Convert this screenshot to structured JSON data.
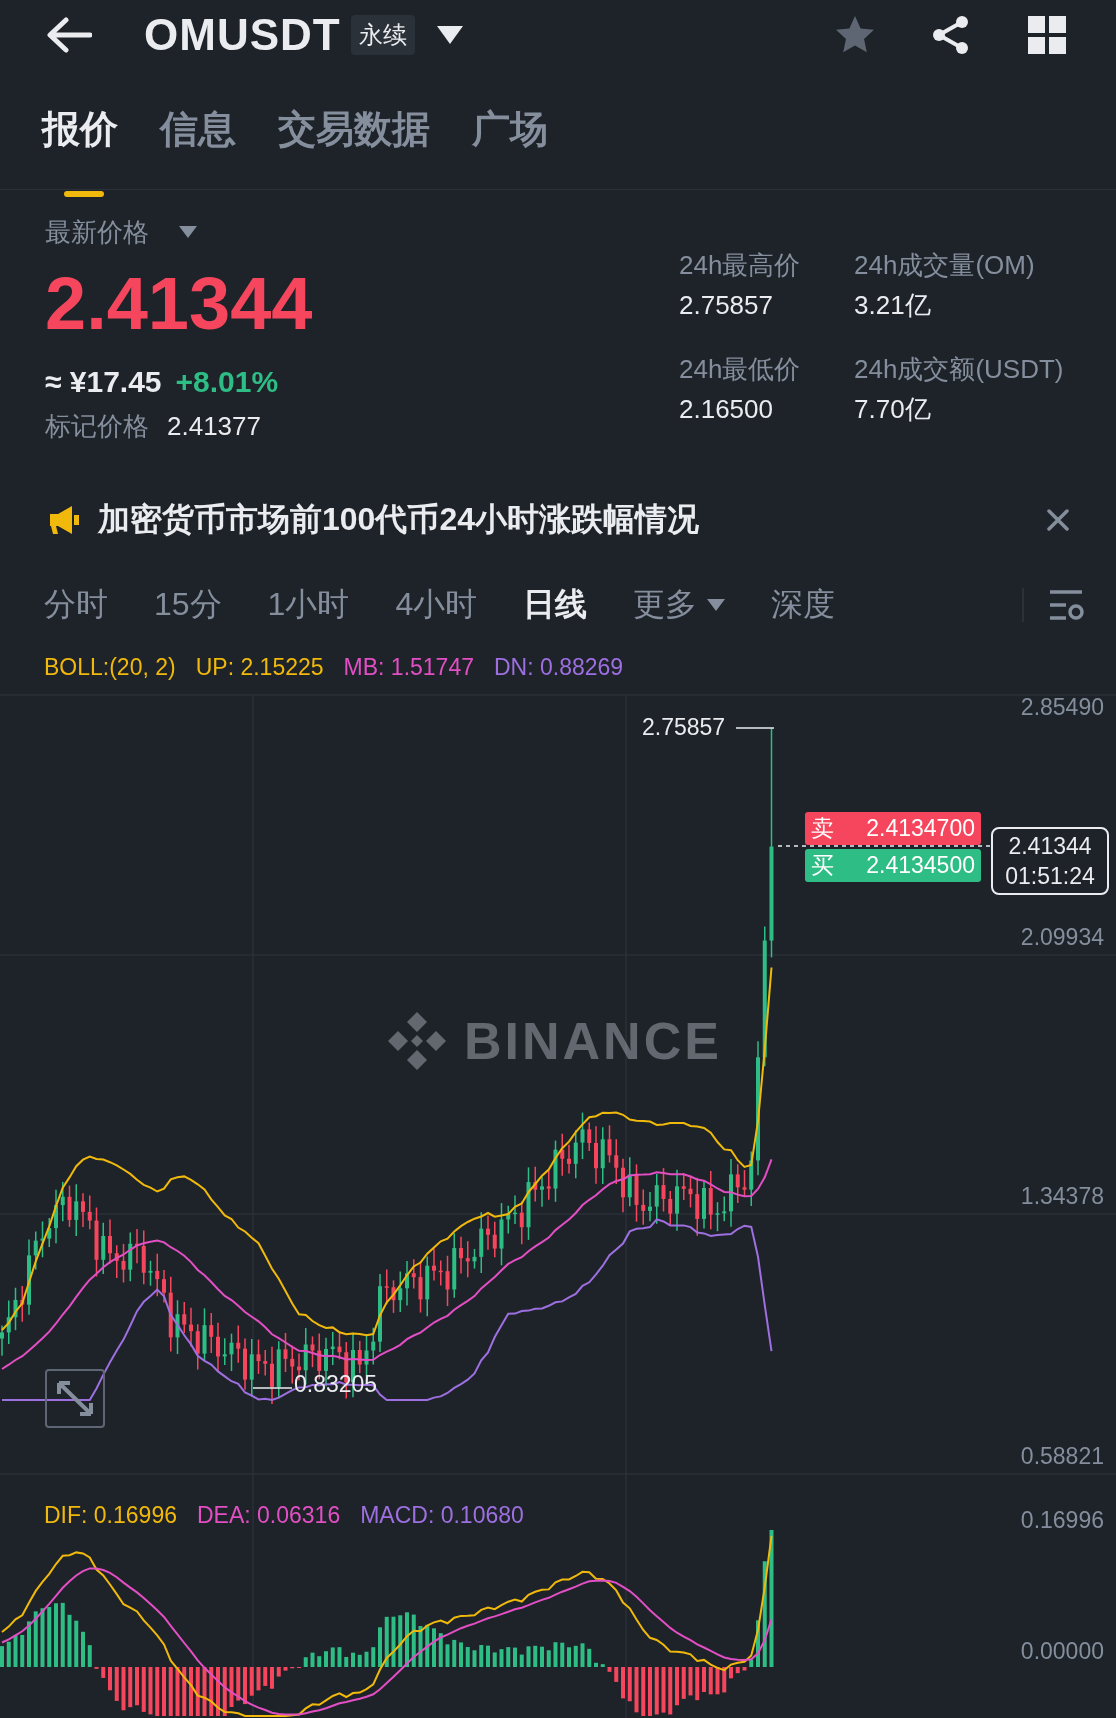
{
  "header": {
    "symbol": "OMUSDT",
    "badge": "永续"
  },
  "tabs": [
    {
      "label": "报价",
      "selected": true
    },
    {
      "label": "信息",
      "selected": false
    },
    {
      "label": "交易数据",
      "selected": false
    },
    {
      "label": "广场",
      "selected": false
    }
  ],
  "price": {
    "label": "最新价格",
    "last": "2.41344",
    "cny": "≈ ¥17.45",
    "change": "+8.01%",
    "mark_label": "标记价格",
    "mark": "2.41377"
  },
  "stats": [
    {
      "label": "24h最高价",
      "value": "2.75857"
    },
    {
      "label": "24h成交量(OM)",
      "value": "3.21亿"
    },
    {
      "label": "24h最低价",
      "value": "2.16500"
    },
    {
      "label": "24h成交额(USDT)",
      "value": "7.70亿"
    }
  ],
  "announcement": {
    "text": "加密货币市场前100代币24小时涨跌幅情况"
  },
  "intervals": [
    {
      "label": "分时",
      "selected": false,
      "kind": "plain"
    },
    {
      "label": "15分",
      "selected": false,
      "kind": "plain"
    },
    {
      "label": "1小时",
      "selected": false,
      "kind": "plain"
    },
    {
      "label": "4小时",
      "selected": false,
      "kind": "plain"
    },
    {
      "label": "日线",
      "selected": true,
      "kind": "plain"
    },
    {
      "label": "更多",
      "selected": false,
      "kind": "dropdown"
    },
    {
      "label": "深度",
      "selected": false,
      "kind": "plain"
    }
  ],
  "chart": {
    "indicator": {
      "text": "BOLL:(20, 2)",
      "color": "#f0b90b"
    },
    "legend": [
      {
        "text": "UP: 2.15225",
        "color": "#f0b90b"
      },
      {
        "text": "MB: 1.51747",
        "color": "#e24fc4"
      },
      {
        "text": "DN: 0.88269",
        "color": "#9d6fe0"
      }
    ],
    "axis": [
      "2.85490",
      "2.09934",
      "1.34378",
      "0.58821"
    ],
    "watermark": "BINANCE",
    "high": "2.75857",
    "low": "0.83205",
    "ask": {
      "label": "卖",
      "price": "2.4134700"
    },
    "bid": {
      "label": "买",
      "price": "2.4134500"
    },
    "current": {
      "price": "2.41344",
      "countdown": "01:51:24"
    }
  },
  "macd": {
    "legend": [
      {
        "text": "DIF: 0.16996",
        "color": "#f0b90b"
      },
      {
        "text": "DEA: 0.06316",
        "color": "#e24fc4"
      },
      {
        "text": "MACD: 0.10680",
        "color": "#9d6fe0"
      }
    ],
    "axis": [
      "0.16996",
      "0.00000"
    ]
  }
}
